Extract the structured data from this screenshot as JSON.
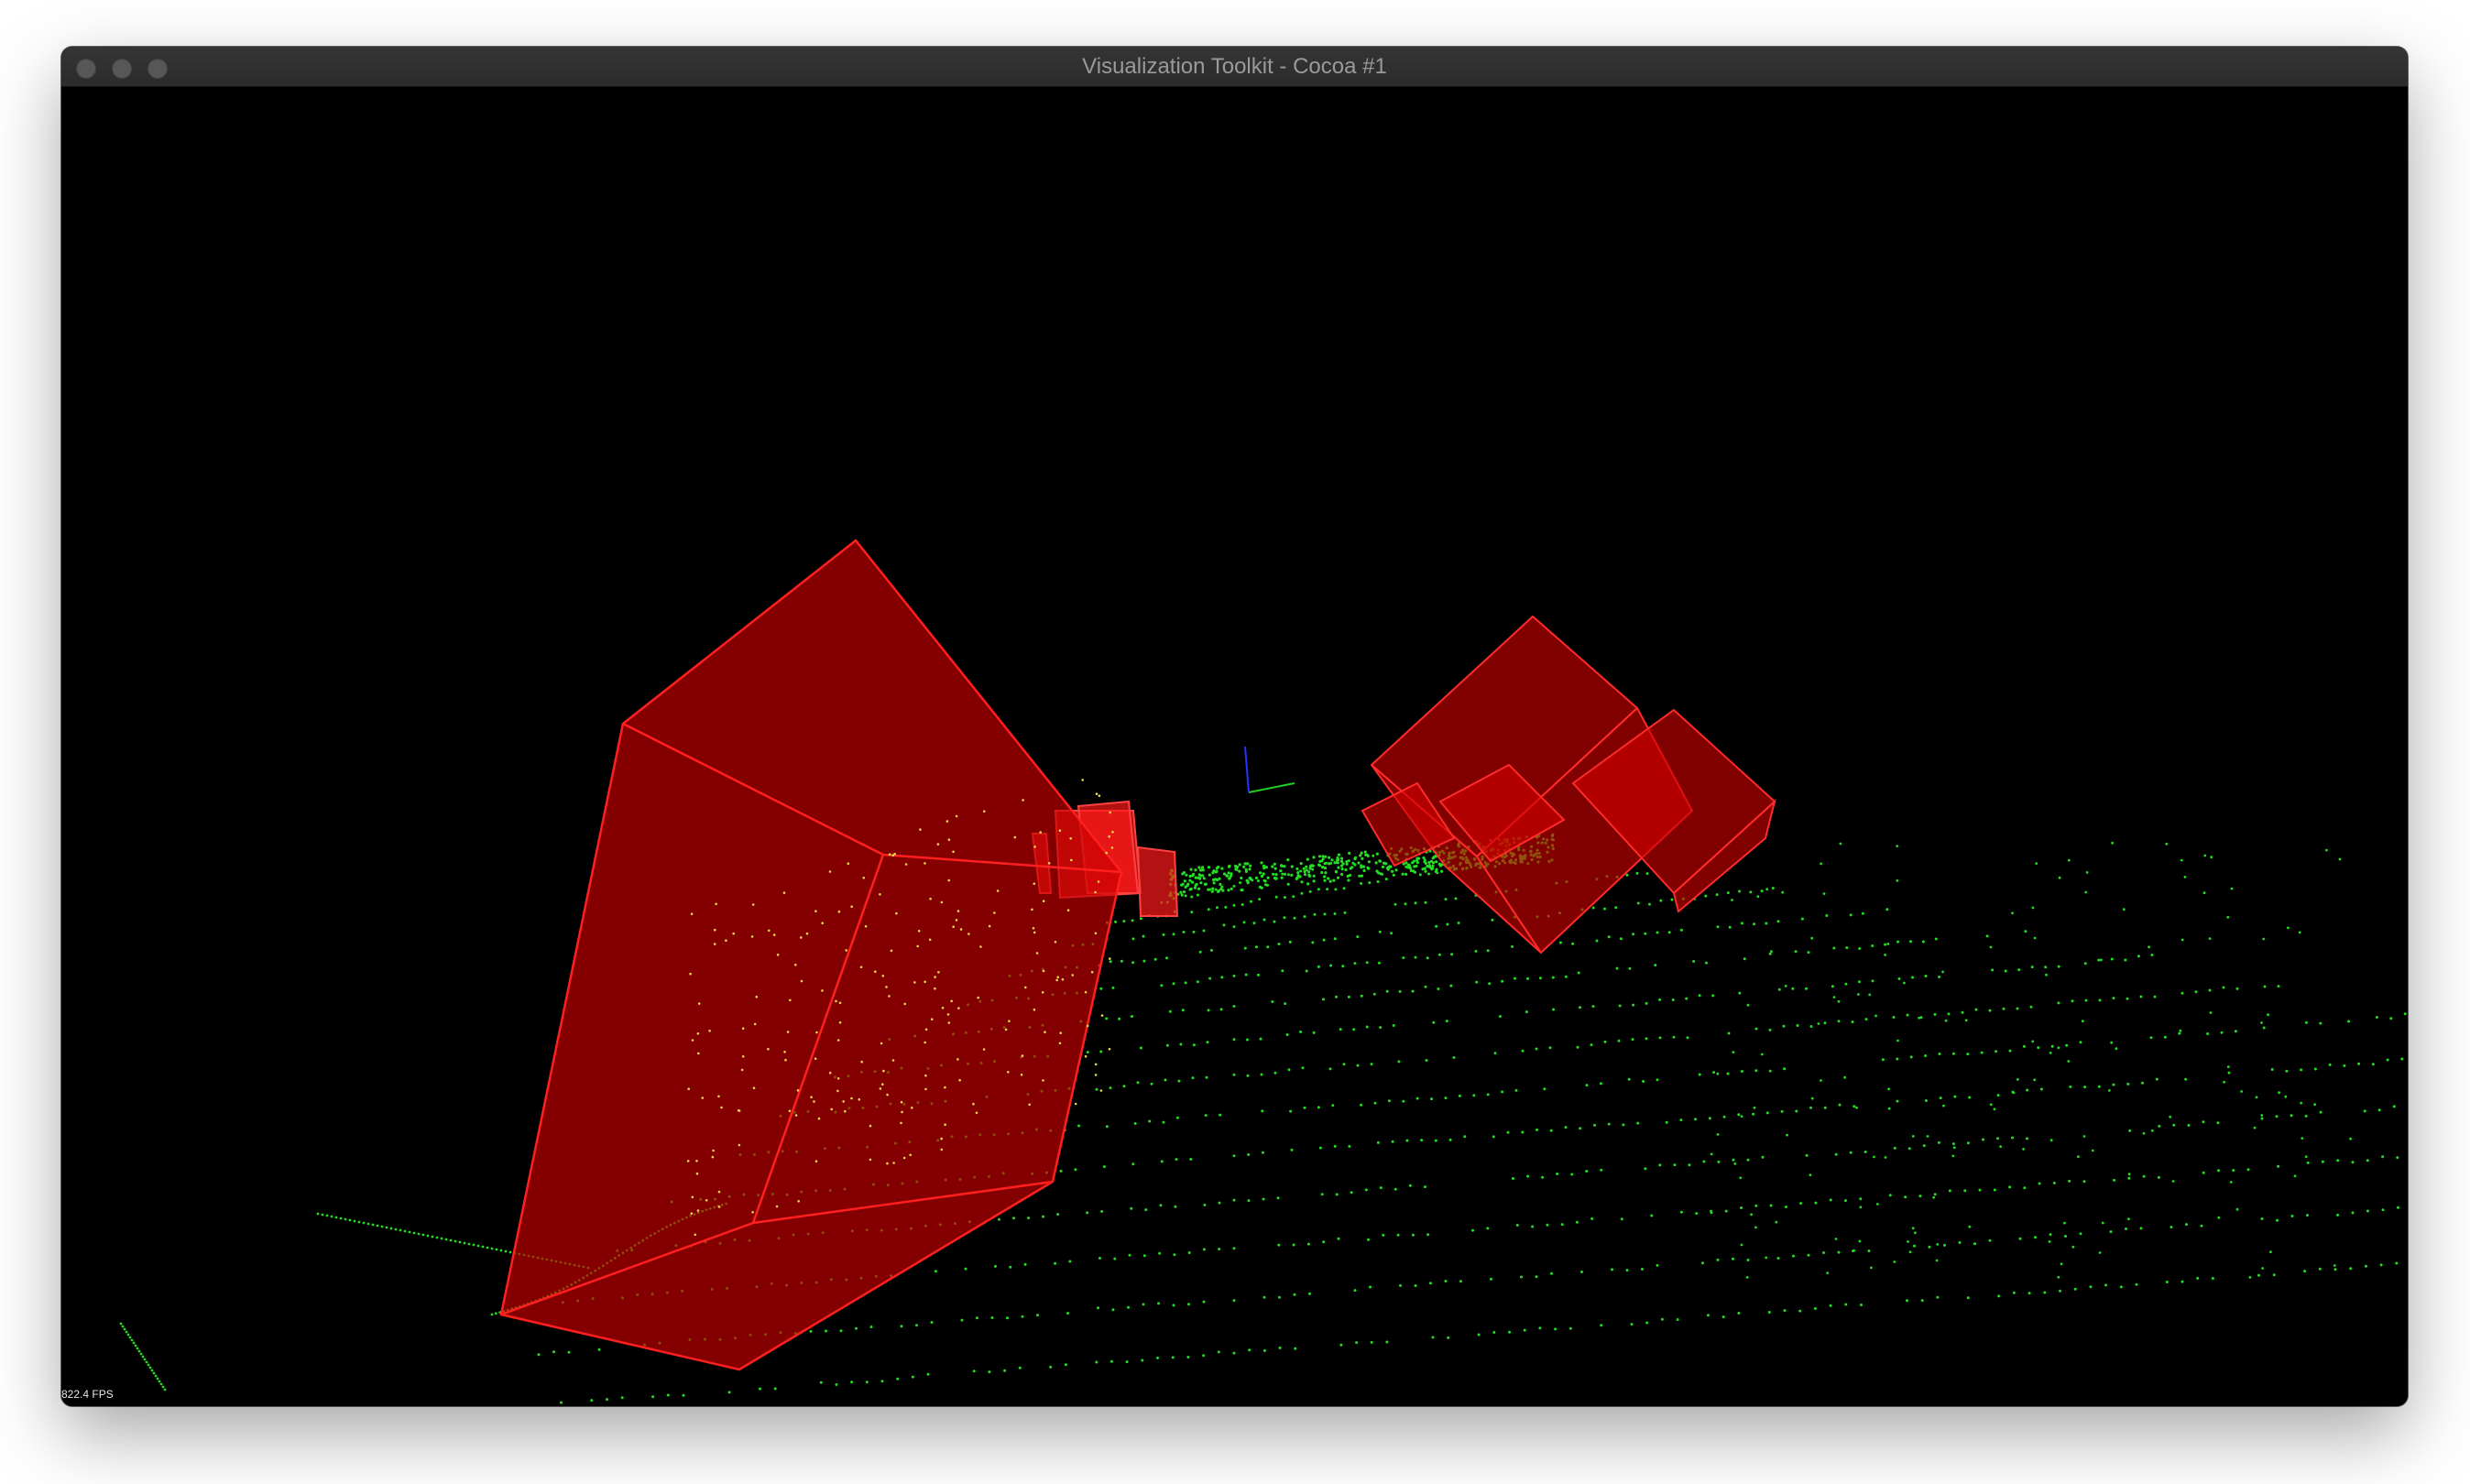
{
  "window": {
    "title": "Visualization Toolkit - Cocoa #1",
    "buttons": [
      "close-icon",
      "minimize-icon",
      "zoom-icon"
    ]
  },
  "viewport": {
    "background": "#000000",
    "fps_text": "822.4 FPS",
    "point_color": "#22dd22",
    "box_color": "#ff0000",
    "axes_colors": {
      "x": "#ff0000",
      "y": "#22cc22",
      "z": "#2233ff"
    }
  }
}
